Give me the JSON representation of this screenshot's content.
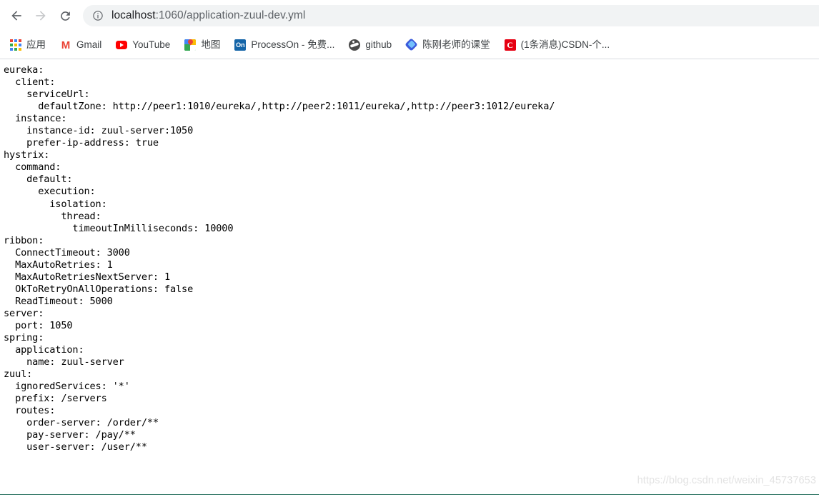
{
  "browser": {
    "nav": {
      "back_label": "Back",
      "forward_label": "Forward",
      "reload_label": "Reload"
    },
    "omnibox": {
      "security_icon": "info-circle-icon",
      "url_host": "localhost",
      "url_rest": ":1060/application-zuul-dev.yml",
      "full_url": "localhost:1060/application-zuul-dev.yml"
    },
    "bookmarks": [
      {
        "label": "应用",
        "icon": "apps-grid-icon"
      },
      {
        "label": "Gmail",
        "icon": "gmail-icon"
      },
      {
        "label": "YouTube",
        "icon": "youtube-icon"
      },
      {
        "label": "地图",
        "icon": "google-maps-icon"
      },
      {
        "label": "ProcessOn - 免费...",
        "icon": "processon-icon"
      },
      {
        "label": "github",
        "icon": "github-icon"
      },
      {
        "label": "陈刚老师的课堂",
        "icon": "blue-diamond-icon"
      },
      {
        "label": "(1条消息)CSDN-个...",
        "icon": "csdn-icon"
      }
    ]
  },
  "content": {
    "yaml": "eureka:\n  client:\n    serviceUrl:\n      defaultZone: http://peer1:1010/eureka/,http://peer2:1011/eureka/,http://peer3:1012/eureka/\n  instance:\n    instance-id: zuul-server:1050\n    prefer-ip-address: true\nhystrix:\n  command:\n    default:\n      execution:\n        isolation:\n          thread:\n            timeoutInMilliseconds: 10000\nribbon:\n  ConnectTimeout: 3000\n  MaxAutoRetries: 1\n  MaxAutoRetriesNextServer: 1\n  OkToRetryOnAllOperations: false\n  ReadTimeout: 5000\nserver:\n  port: 1050\nspring:\n  application:\n    name: zuul-server\nzuul:\n  ignoredServices: '*'\n  prefix: /servers\n  routes:\n    order-server: /order/**\n    pay-server: /pay/**\n    user-server: /user/**",
    "watermark": "https://blog.csdn.net/weixin_45737653"
  },
  "colors": {
    "page_background": "#ffffff",
    "text": "#000000",
    "omnibox_background": "#f1f3f4",
    "omnibox_host_text": "#202124",
    "omnibox_path_text": "#5f6368",
    "bookmark_text": "#3c4043",
    "watermark_text": "#e3e3e3",
    "bottom_rule": "#3e8070",
    "google_blue": "#4285f4",
    "google_red": "#ea4335",
    "google_yellow": "#fbbc05",
    "google_green": "#34a853",
    "youtube_red": "#ff0000",
    "processon_blue": "#1565a8",
    "csdn_red": "#e60012"
  }
}
